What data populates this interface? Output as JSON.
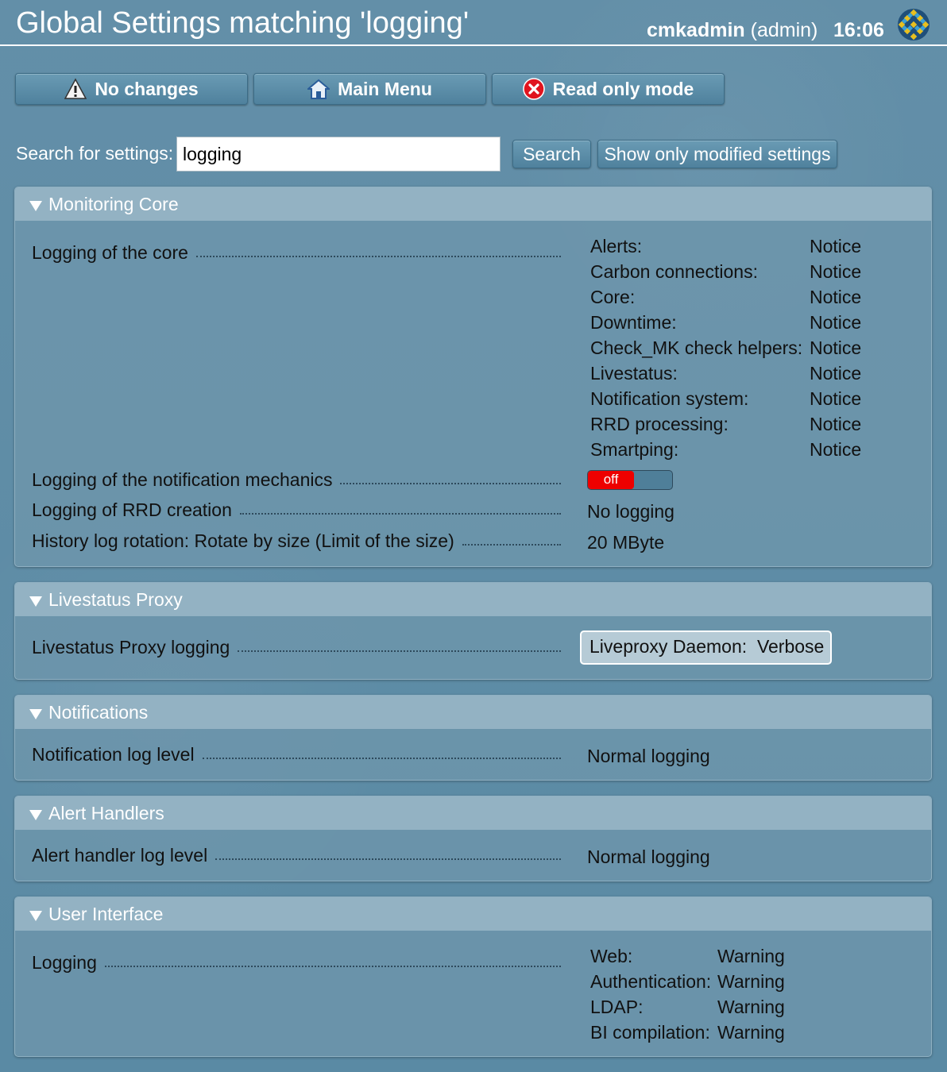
{
  "header": {
    "title": "Global Settings matching 'logging'",
    "username": "cmkadmin",
    "role": "(admin)",
    "time": "16:06",
    "logo_icon": "globe-icon"
  },
  "toolbar": {
    "changes_label": "No changes",
    "changes_icon": "warning-icon",
    "main_menu_label": "Main Menu",
    "main_menu_icon": "home-icon",
    "readonly_label": "Read only mode",
    "readonly_icon": "error-x-icon"
  },
  "search": {
    "label": "Search for settings:",
    "value": "logging",
    "button": "Search",
    "modified_button": "Show only modified settings"
  },
  "sections": {
    "monitoring_core": {
      "title": "Monitoring Core",
      "core_logging": {
        "label": "Logging of the core",
        "items": [
          {
            "key": "Alerts:",
            "value": "Notice"
          },
          {
            "key": "Carbon connections:",
            "value": "Notice"
          },
          {
            "key": "Core:",
            "value": "Notice"
          },
          {
            "key": "Downtime:",
            "value": "Notice"
          },
          {
            "key": "Check_MK check helpers:",
            "value": "Notice"
          },
          {
            "key": "Livestatus:",
            "value": "Notice"
          },
          {
            "key": "Notification system:",
            "value": "Notice"
          },
          {
            "key": "RRD processing:",
            "value": "Notice"
          },
          {
            "key": "Smartping:",
            "value": "Notice"
          }
        ]
      },
      "notification_mechanics": {
        "label": "Logging of the notification mechanics",
        "toggle": "off"
      },
      "rrd_creation": {
        "label": "Logging of RRD creation",
        "value": "No logging"
      },
      "history_rotation": {
        "label": "History log rotation: Rotate by size (Limit of the size)",
        "value": "20 MByte"
      }
    },
    "livestatus_proxy": {
      "title": "Livestatus Proxy",
      "label": "Livestatus Proxy logging",
      "key": "Liveproxy Daemon:",
      "value": "Verbose"
    },
    "notifications": {
      "title": "Notifications",
      "label": "Notification log level",
      "value": "Normal logging"
    },
    "alert_handlers": {
      "title": "Alert Handlers",
      "label": "Alert handler log level",
      "value": "Normal logging"
    },
    "user_interface": {
      "title": "User Interface",
      "label": "Logging",
      "items": [
        {
          "key": "Web:",
          "value": "Warning"
        },
        {
          "key": "Authentication:",
          "value": "Warning"
        },
        {
          "key": "LDAP:",
          "value": "Warning"
        },
        {
          "key": "BI compilation:",
          "value": "Warning"
        }
      ]
    }
  },
  "colors": {
    "background": "#5f8ea8",
    "section_header": "#93b2c3",
    "toggle_off": "#ee0000"
  }
}
